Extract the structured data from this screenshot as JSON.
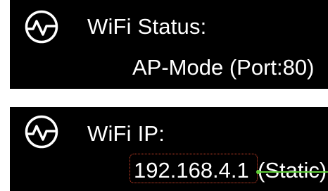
{
  "status": {
    "icon": "activity-pulse-icon",
    "label": "WiFi Status:",
    "value": "AP-Mode (Port:80)"
  },
  "ip": {
    "icon": "activity-pulse-icon",
    "label": "WiFi IP:",
    "address": "192.168.4.1",
    "mode": "(Static)"
  },
  "colors": {
    "panel": "#000000",
    "text": "#ffffff",
    "highlight_border": "#e64a2e",
    "strike": "#5fcf3a"
  }
}
